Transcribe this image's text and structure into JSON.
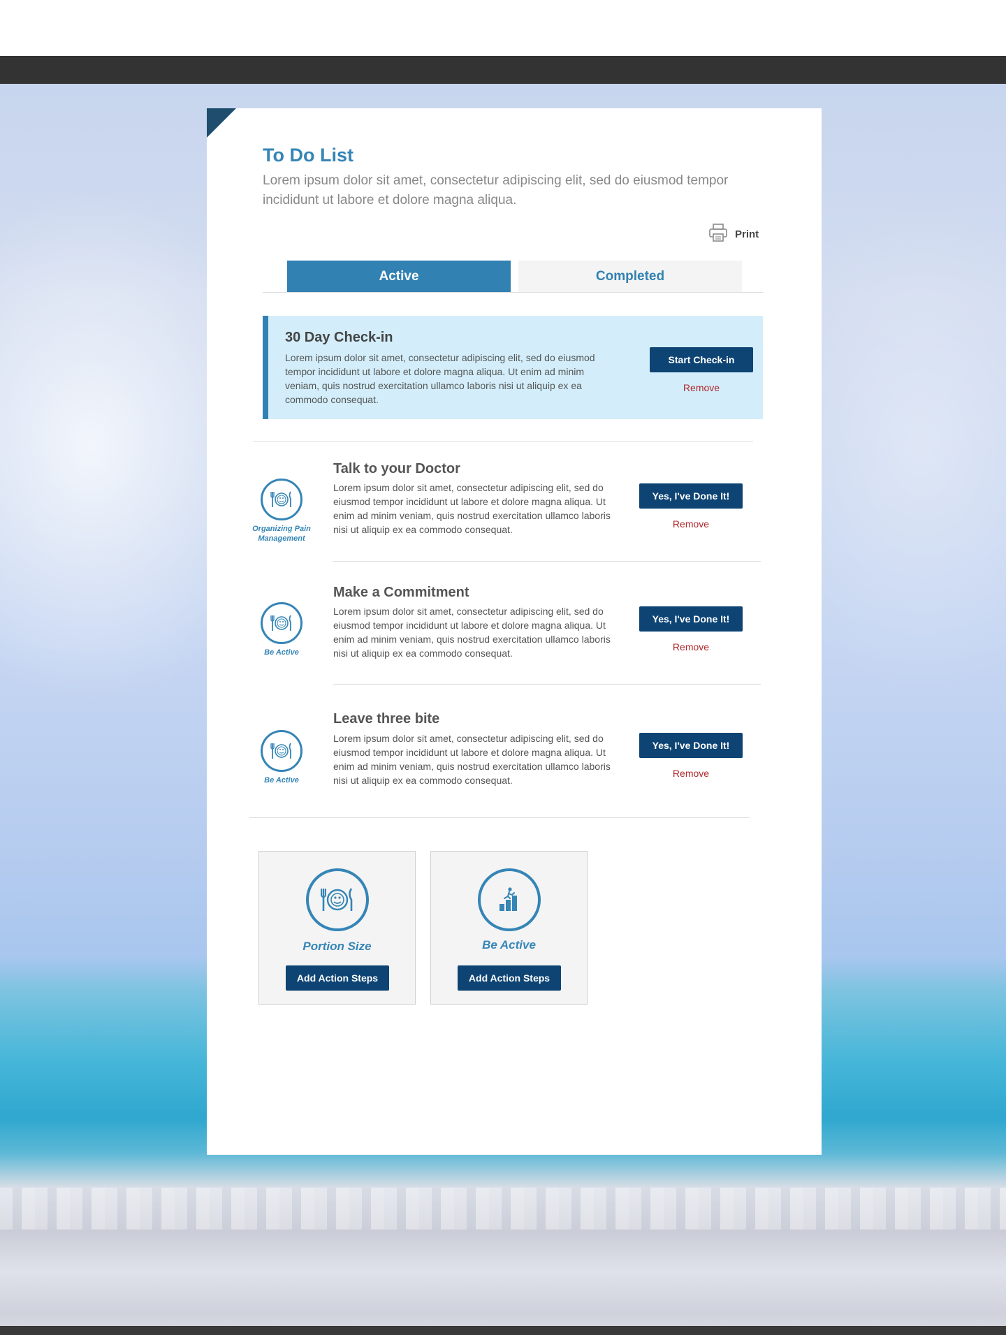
{
  "header": {
    "title": "To Do List",
    "subtitle": "Lorem ipsum dolor sit amet, consectetur adipiscing elit, sed do eiusmod tempor incididunt ut labore et dolore magna aliqua.",
    "print_label": "Print"
  },
  "tabs": [
    {
      "label": "Active",
      "selected": true
    },
    {
      "label": "Completed",
      "selected": false
    }
  ],
  "checkin": {
    "title": "30 Day Check-in",
    "description": "Lorem ipsum dolor sit amet, consectetur adipiscing elit, sed do eiusmod tempor incididunt ut labore et dolore magna aliqua. Ut enim ad minim veniam, quis nostrud exercitation ullamco laboris nisi ut aliquip ex ea commodo consequat.",
    "button_label": "Start Check-in",
    "remove_label": "Remove"
  },
  "tasks": [
    {
      "title": "Talk to your Doctor",
      "category": "Organizing Pain Management",
      "icon": "plate-fork-knife-icon",
      "description": "Lorem ipsum dolor sit amet, consectetur adipiscing elit, sed do eiusmod tempor incididunt ut labore et dolore magna aliqua. Ut enim ad minim veniam, quis nostrud exercitation ullamco laboris nisi ut aliquip ex ea commodo consequat.",
      "done_label": "Yes, I've Done It!",
      "remove_label": "Remove"
    },
    {
      "title": "Make a Commitment",
      "category": "Be Active",
      "icon": "plate-fork-knife-icon",
      "description": "Lorem ipsum dolor sit amet, consectetur adipiscing elit, sed do eiusmod tempor incididunt ut labore et dolore magna aliqua. Ut enim ad minim veniam, quis nostrud exercitation ullamco laboris nisi ut aliquip ex ea commodo consequat.",
      "done_label": "Yes, I've Done It!",
      "remove_label": "Remove"
    },
    {
      "title": "Leave three bite",
      "category": "Be Active",
      "icon": "plate-fork-knife-icon",
      "description": "Lorem ipsum dolor sit amet, consectetur adipiscing elit, sed do eiusmod tempor incididunt ut labore et dolore magna aliqua. Ut enim ad minim veniam, quis nostrud exercitation ullamco laboris nisi ut aliquip ex ea commodo consequat.",
      "done_label": "Yes, I've Done It!",
      "remove_label": "Remove"
    }
  ],
  "tiles": [
    {
      "label": "Portion Size",
      "icon": "plate-fork-knife-icon",
      "button_label": "Add Action Steps"
    },
    {
      "label": "Be Active",
      "icon": "running-chart-icon",
      "button_label": "Add Action Steps"
    }
  ],
  "colors": {
    "brand_blue": "#3181b2",
    "dark_navy": "#0d4474",
    "checkin_bg": "#d3eefa",
    "remove_red": "#b0282c"
  }
}
